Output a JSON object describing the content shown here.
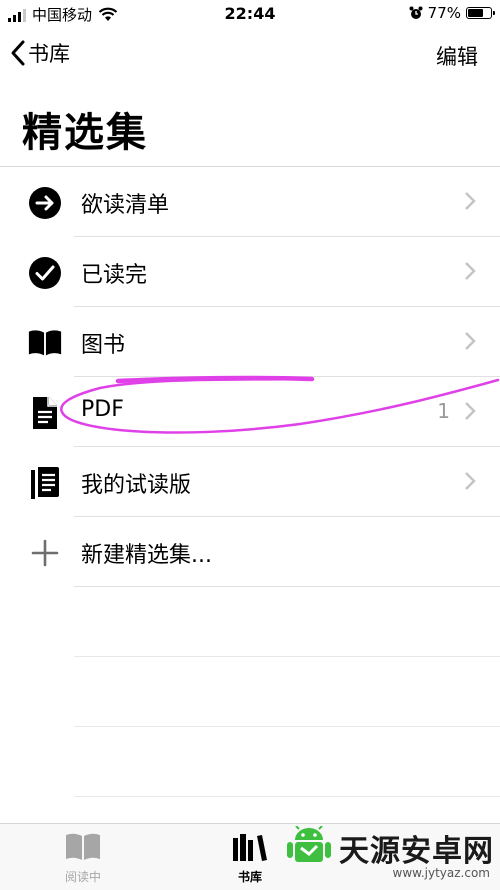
{
  "status_bar": {
    "carrier": "中国移动",
    "time": "22:44",
    "battery_percent": "77%",
    "battery_level": 0.77
  },
  "nav": {
    "back_label": "书库",
    "edit_label": "编辑"
  },
  "page_title": "精选集",
  "list": {
    "items": [
      {
        "label": "欲读清单",
        "icon": "arrow-right-circle-icon",
        "count": ""
      },
      {
        "label": "已读完",
        "icon": "checkmark-circle-icon",
        "count": ""
      },
      {
        "label": "图书",
        "icon": "open-book-icon",
        "count": ""
      },
      {
        "label": "PDF",
        "icon": "document-icon",
        "count": "1"
      },
      {
        "label": "我的试读版",
        "icon": "sample-pages-icon",
        "count": ""
      },
      {
        "label": "新建精选集...",
        "icon": "plus-icon",
        "count": ""
      }
    ]
  },
  "tabs": [
    {
      "label": "阅读中",
      "icon": "open-book-icon",
      "active": false
    },
    {
      "label": "书库",
      "icon": "library-books-icon",
      "active": true
    }
  ],
  "watermark": {
    "text": "天源安卓网",
    "url": "www.jytyaz.com"
  },
  "colors": {
    "annotation": "#e040e8",
    "separator": "#e0e0e0",
    "inactive_tab": "#a6a6a6"
  }
}
